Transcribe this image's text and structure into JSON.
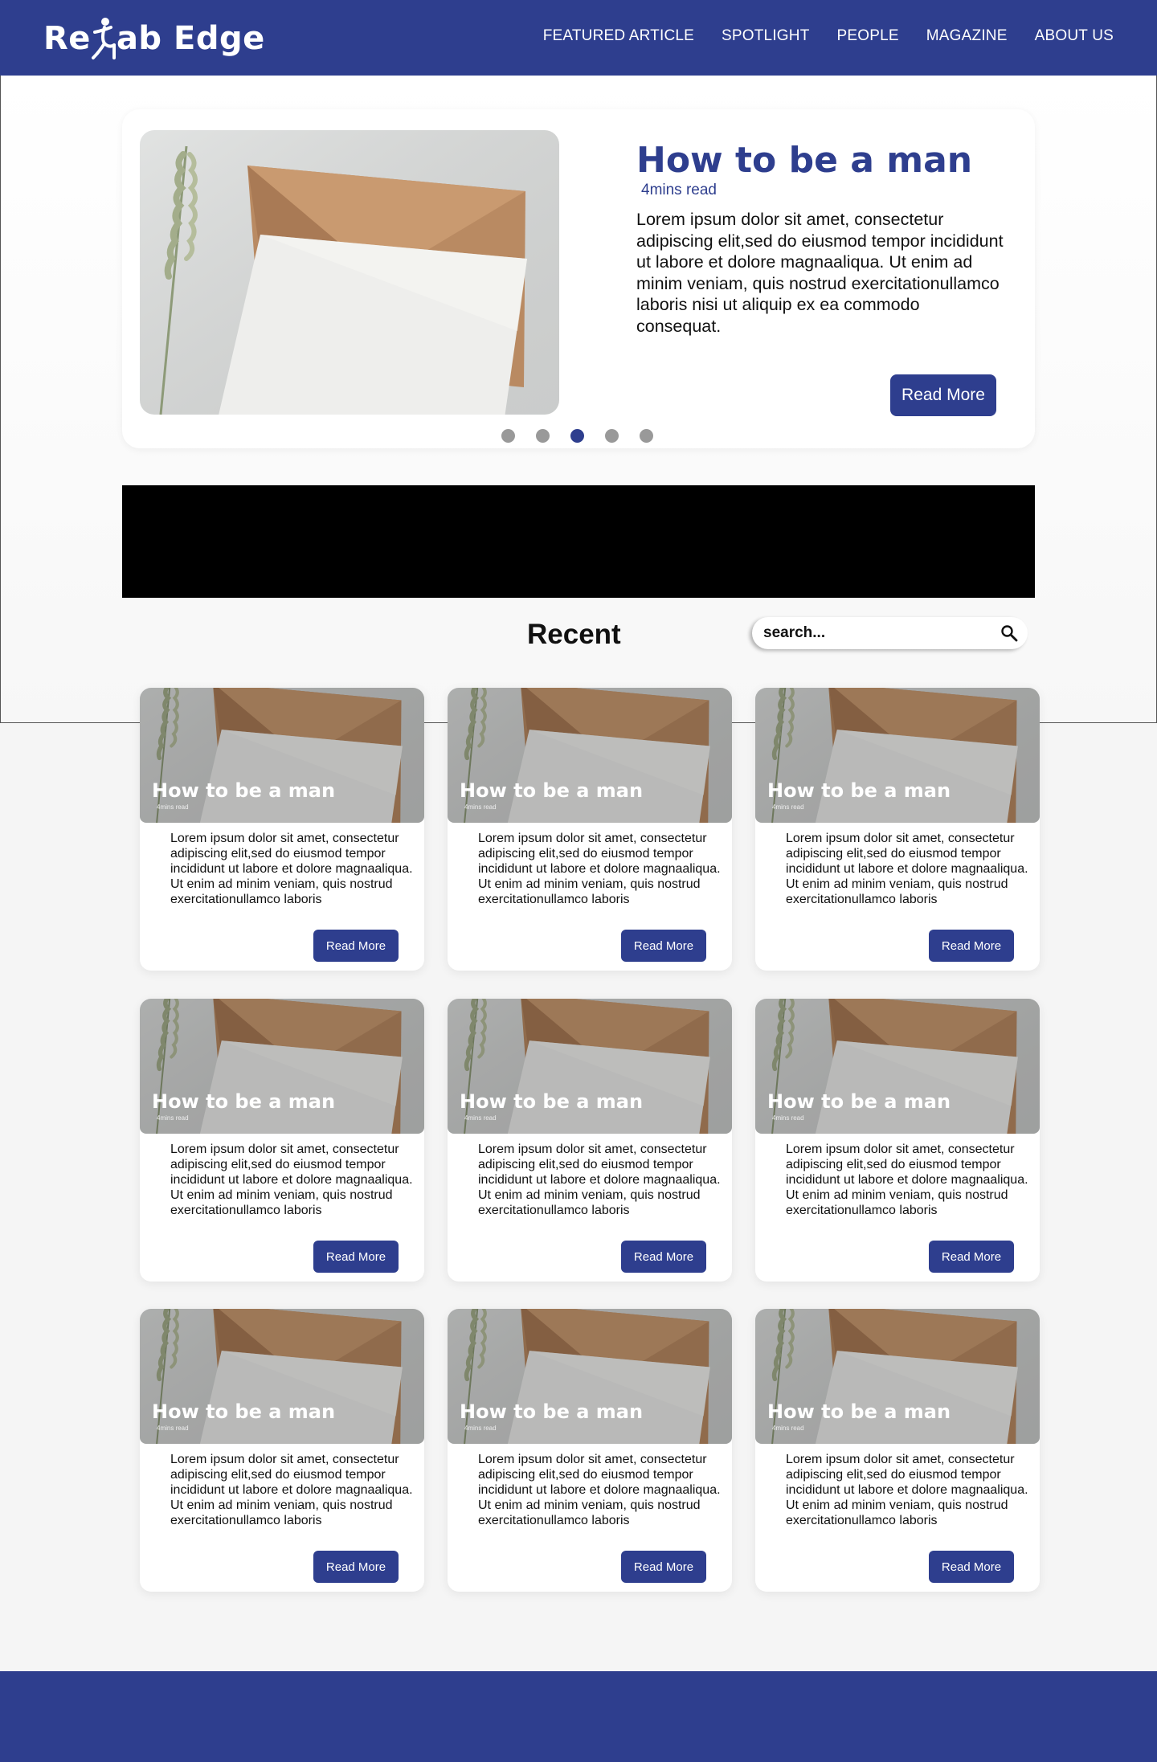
{
  "brand": {
    "name_part1": "Re",
    "name_part2": "ab Edge",
    "accent": "#2e3e8e"
  },
  "nav": {
    "items": [
      {
        "label": "FEATURED ARTICLE"
      },
      {
        "label": "SPOTLIGHT"
      },
      {
        "label": "PEOPLE"
      },
      {
        "label": "MAGAZINE"
      },
      {
        "label": "ABOUT US"
      }
    ]
  },
  "featured": {
    "title": "How to be a man",
    "read_time": "4mins read",
    "body": "Lorem ipsum dolor sit amet, consectetur adipiscing elit,sed do eiusmod tempor incididunt ut labore et dolore magnaaliqua. Ut enim ad minim veniam, quis nostrud exercitationullamco laboris nisi ut aliquip ex ea commodo consequat.",
    "button_label": "Read More",
    "carousel": {
      "slides": 5,
      "active_index": 2
    }
  },
  "recent": {
    "title": "Recent",
    "search_placeholder": "search...",
    "search_icon": "search-icon"
  },
  "cards": [
    {
      "title": "How to be a man",
      "read_time": "4mins read",
      "body": "Lorem ipsum dolor sit amet, consectetur adipiscing elit,sed do eiusmod tempor incididunt ut labore et dolore magnaaliqua. Ut enim ad minim veniam, quis nostrud exercitationullamco laboris",
      "button_label": "Read More"
    },
    {
      "title": "How to be a man",
      "read_time": "4mins read",
      "body": "Lorem ipsum dolor sit amet, consectetur adipiscing elit,sed do eiusmod tempor incididunt ut labore et dolore magnaaliqua. Ut enim ad minim veniam, quis nostrud exercitationullamco laboris",
      "button_label": "Read More"
    },
    {
      "title": "How to be a man",
      "read_time": "4mins read",
      "body": "Lorem ipsum dolor sit amet, consectetur adipiscing elit,sed do eiusmod tempor incididunt ut labore et dolore magnaaliqua. Ut enim ad minim veniam, quis nostrud exercitationullamco laboris",
      "button_label": "Read More"
    },
    {
      "title": "How to be a man",
      "read_time": "4mins read",
      "body": "Lorem ipsum dolor sit amet, consectetur adipiscing elit,sed do eiusmod tempor incididunt ut labore et dolore magnaaliqua. Ut enim ad minim veniam, quis nostrud exercitationullamco laboris",
      "button_label": "Read More"
    },
    {
      "title": "How to be a man",
      "read_time": "4mins read",
      "body": "Lorem ipsum dolor sit amet, consectetur adipiscing elit,sed do eiusmod tempor incididunt ut labore et dolore magnaaliqua. Ut enim ad minim veniam, quis nostrud exercitationullamco laboris",
      "button_label": "Read More"
    },
    {
      "title": "How to be a man",
      "read_time": "4mins read",
      "body": "Lorem ipsum dolor sit amet, consectetur adipiscing elit,sed do eiusmod tempor incididunt ut labore et dolore magnaaliqua. Ut enim ad minim veniam, quis nostrud exercitationullamco laboris",
      "button_label": "Read More"
    },
    {
      "title": "How to be a man",
      "read_time": "4mins read",
      "body": "Lorem ipsum dolor sit amet, consectetur adipiscing elit,sed do eiusmod tempor incididunt ut labore et dolore magnaaliqua. Ut enim ad minim veniam, quis nostrud exercitationullamco laboris",
      "button_label": "Read More"
    },
    {
      "title": "How to be a man",
      "read_time": "4mins read",
      "body": "Lorem ipsum dolor sit amet, consectetur adipiscing elit,sed do eiusmod tempor incididunt ut labore et dolore magnaaliqua. Ut enim ad minim veniam, quis nostrud exercitationullamco laboris",
      "button_label": "Read More"
    },
    {
      "title": "How to be a man",
      "read_time": "4mins read",
      "body": "Lorem ipsum dolor sit amet, consectetur adipiscing elit,sed do eiusmod tempor incididunt ut labore et dolore magnaaliqua. Ut enim ad minim veniam, quis nostrud exercitationullamco laboris",
      "button_label": "Read More"
    }
  ]
}
